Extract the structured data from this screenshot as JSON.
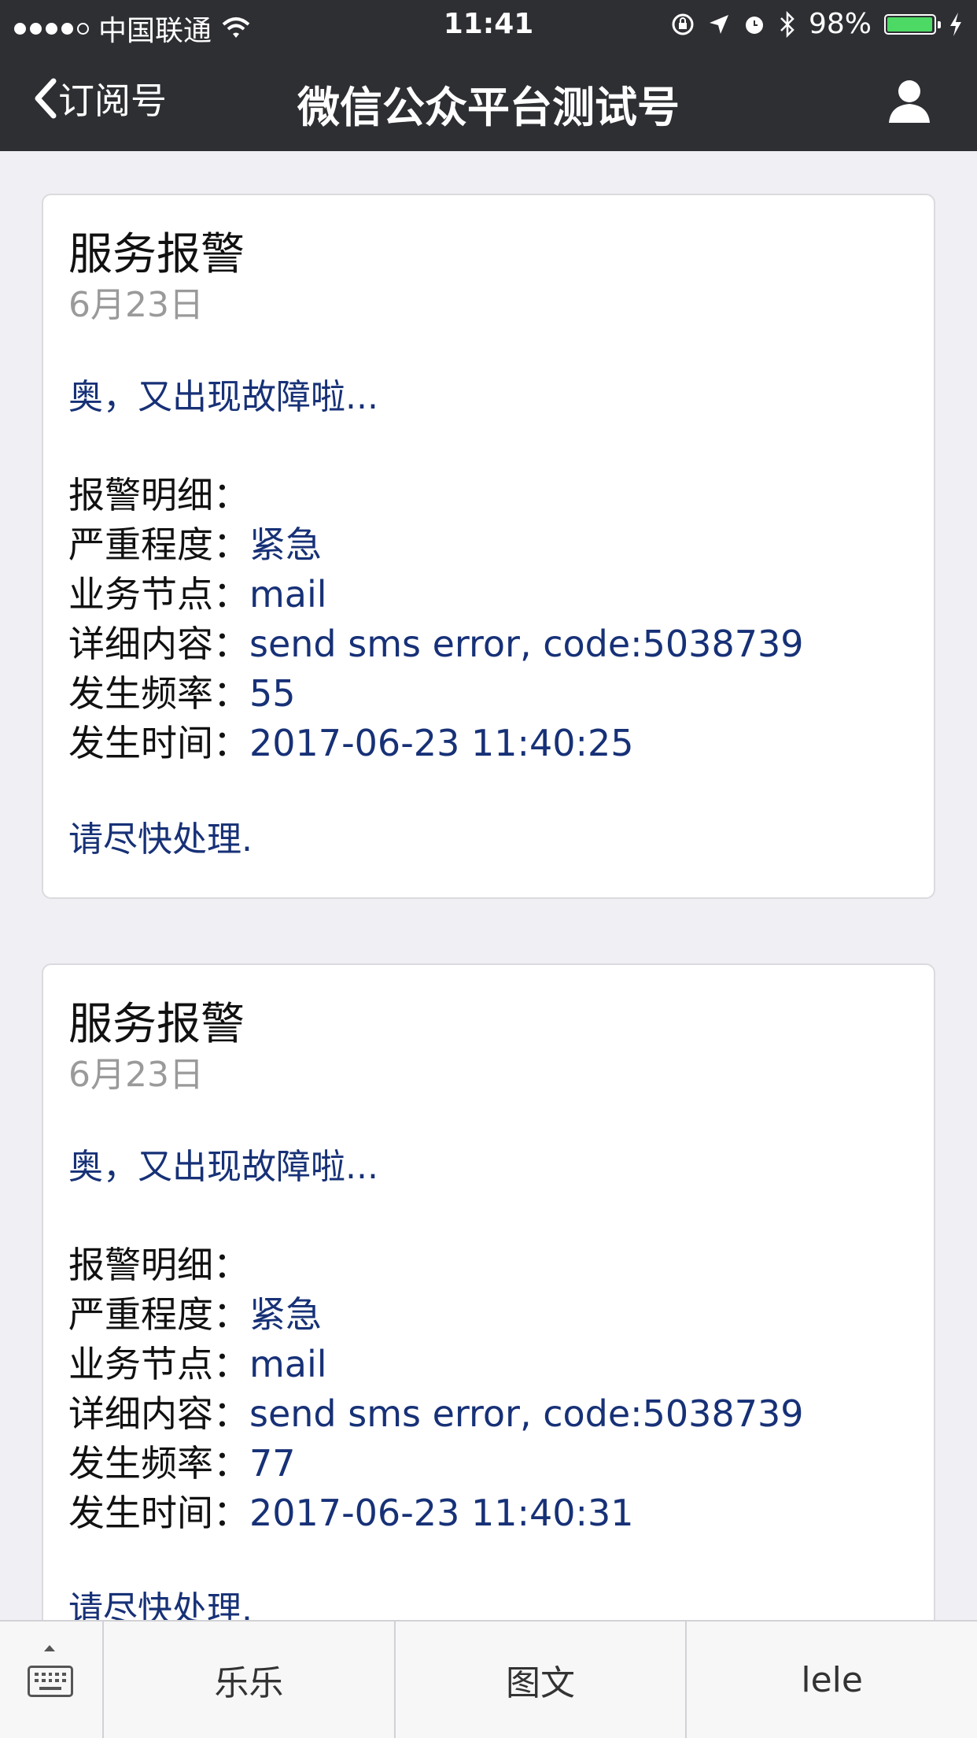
{
  "status_bar": {
    "carrier": "中国联通",
    "time": "11:41",
    "battery": "98%",
    "battery_level": 0.98
  },
  "nav": {
    "back_label": "订阅号",
    "title": "微信公众平台测试号"
  },
  "messages": [
    {
      "title": "服务报警",
      "date": "6月23日",
      "first": "奥，又出现故障啦...",
      "details_label": "报警明细：",
      "fields": [
        {
          "label": "严重程度：",
          "value": "紧急"
        },
        {
          "label": "业务节点：",
          "value": "mail"
        },
        {
          "label": "详细内容：",
          "value": "send sms error, code:5038739"
        },
        {
          "label": "发生频率：",
          "value": "55"
        },
        {
          "label": "发生时间：",
          "value": "2017-06-23 11:40:25"
        }
      ],
      "remark": "请尽快处理."
    },
    {
      "title": "服务报警",
      "date": "6月23日",
      "first": "奥，又出现故障啦...",
      "details_label": "报警明细：",
      "fields": [
        {
          "label": "严重程度：",
          "value": "紧急"
        },
        {
          "label": "业务节点：",
          "value": "mail"
        },
        {
          "label": "详细内容：",
          "value": "send sms error, code:5038739"
        },
        {
          "label": "发生频率：",
          "value": "77"
        },
        {
          "label": "发生时间：",
          "value": "2017-06-23 11:40:31"
        }
      ],
      "remark": "请尽快处理."
    }
  ],
  "bottom_menu": {
    "items": [
      "乐乐",
      "图文",
      "lele"
    ]
  },
  "colors": {
    "nav_bg": "#2e2f33",
    "value_text": "#173177",
    "page_bg": "#efeff4"
  }
}
